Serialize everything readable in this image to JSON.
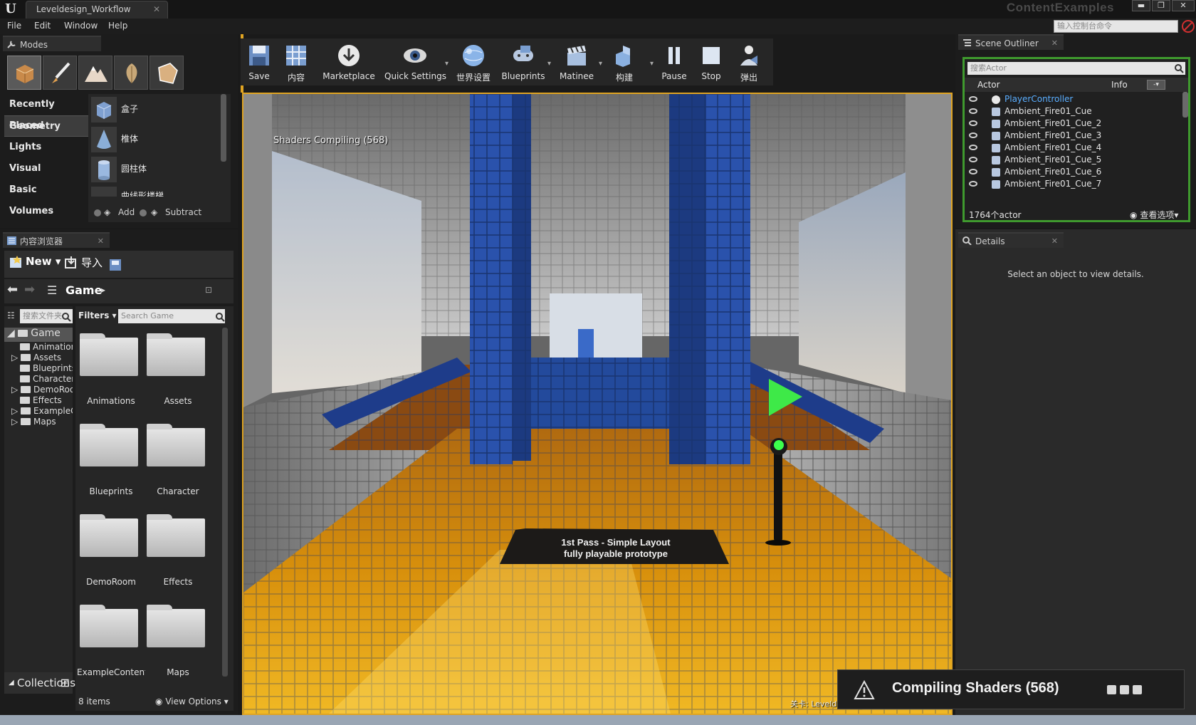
{
  "window": {
    "tab_title": "Leveldesign_Workflow",
    "project_name": "ContentExamples",
    "min_label": "▬",
    "max_label": "❐",
    "close_label": "✕"
  },
  "menu": {
    "items": [
      "File",
      "Edit",
      "Window",
      "Help"
    ],
    "console_placeholder": "输入控制台命令"
  },
  "modes": {
    "tab_label": "Modes",
    "categories": [
      "Recently Placed",
      "Geometry",
      "Lights",
      "Visual",
      "Basic",
      "Volumes"
    ],
    "selected_category": "Geometry",
    "items": [
      "盒子",
      "椎体",
      "圆柱体",
      "曲线形楼梯"
    ],
    "add_label": "Add",
    "subtract_label": "Subtract"
  },
  "content_browser": {
    "tab_label": "内容浏览器",
    "new_label": "New",
    "import_label": "导入",
    "path": "Game",
    "tree_search_placeholder": "搜索文件夹",
    "tree_root": "Game",
    "tree_children": [
      "Animations",
      "Assets",
      "Blueprints",
      "Character",
      "DemoRoom",
      "Effects",
      "ExampleContent",
      "Maps"
    ],
    "filters_label": "Filters",
    "search_placeholder": "Search Game",
    "folders": [
      "Animations",
      "Assets",
      "Blueprints",
      "Character",
      "DemoRoom",
      "Effects",
      "ExampleContent",
      "Maps"
    ],
    "items_count": "8 items",
    "view_options": "View Options",
    "collections_label": "Collections"
  },
  "toolbar": {
    "save": "Save",
    "content": "内容",
    "marketplace": "Marketplace",
    "quick_settings": "Quick Settings",
    "world_settings": "世界设置",
    "blueprints": "Blueprints",
    "matinee": "Matinee",
    "build": "构建",
    "pause": "Pause",
    "stop": "Stop",
    "eject": "弹出"
  },
  "viewport": {
    "shaders_compiling": "Shaders Compiling (568)",
    "sign_line1": "1st Pass - Simple Layout",
    "sign_line2": "fully playable prototype",
    "level_label": "关卡: Leveldesign_Workflow (Persistent)"
  },
  "outliner": {
    "tab_label": "Scene Outliner",
    "search_placeholder": "搜索Actor",
    "col_actor": "Actor",
    "col_info": "Info",
    "rows": [
      "PlayerController",
      "Ambient_Fire01_Cue",
      "Ambient_Fire01_Cue_2",
      "Ambient_Fire01_Cue_3",
      "Ambient_Fire01_Cue_4",
      "Ambient_Fire01_Cue_5",
      "Ambient_Fire01_Cue_6",
      "Ambient_Fire01_Cue_7"
    ],
    "count": "1764个actor",
    "view_options": "查看选项"
  },
  "details": {
    "tab_label": "Details",
    "empty_message": "Select an object to view details."
  },
  "notification": {
    "text": "Compiling Shaders (568)"
  },
  "colors": {
    "accent_orange": "#e0a422",
    "outliner_green": "#3f9a2e",
    "player_controller_blue": "#5aaeff"
  }
}
